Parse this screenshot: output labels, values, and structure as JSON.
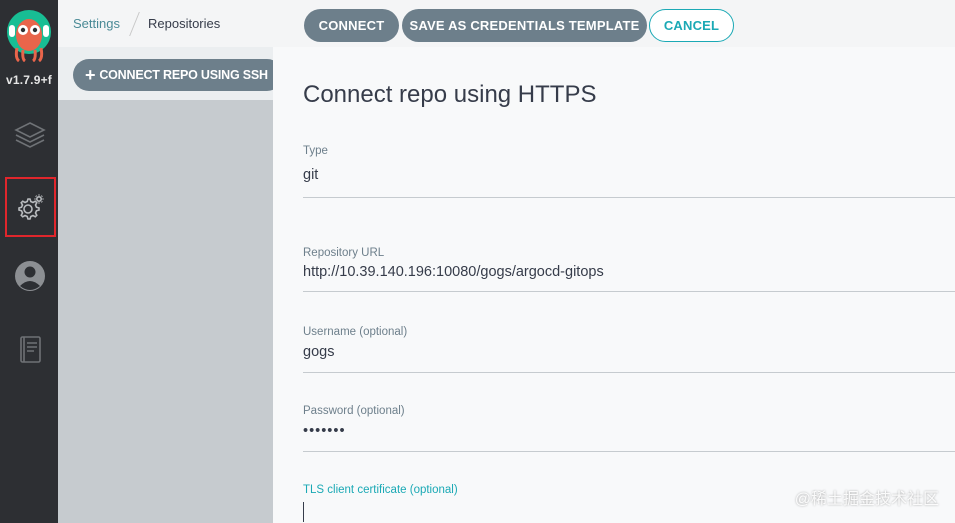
{
  "app": {
    "version": "v1.7.9+f"
  },
  "nav": {
    "items": [
      {
        "icon": "layers-icon"
      },
      {
        "icon": "gear-icon",
        "active": true
      },
      {
        "icon": "user-icon"
      },
      {
        "icon": "docs-icon"
      }
    ]
  },
  "breadcrumb": {
    "settings": "Settings",
    "current": "Repositories"
  },
  "toolbar": {
    "connect_ssh_label": "CONNECT REPO USING SSH"
  },
  "panel": {
    "buttons": {
      "connect": "CONNECT",
      "save_template": "SAVE AS CREDENTIALS TEMPLATE",
      "cancel": "CANCEL"
    },
    "title": "Connect repo using HTTPS",
    "fields": {
      "type": {
        "label": "Type",
        "value": "git"
      },
      "repo_url": {
        "label": "Repository URL",
        "value": "http://10.39.140.196:10080/gogs/argocd-gitops"
      },
      "username": {
        "label": "Username (optional)",
        "value": "gogs"
      },
      "password": {
        "label": "Password (optional)",
        "value": "•••••••"
      },
      "tls_cert": {
        "label": "TLS client certificate (optional)",
        "value": ""
      }
    }
  },
  "colors": {
    "accent": "#1ba9b5",
    "button": "#6d7f8b",
    "nav_bg": "#2d2f33",
    "highlight": "#e0262c"
  },
  "watermark": {
    "text": "@稀土掘金技术社区"
  }
}
